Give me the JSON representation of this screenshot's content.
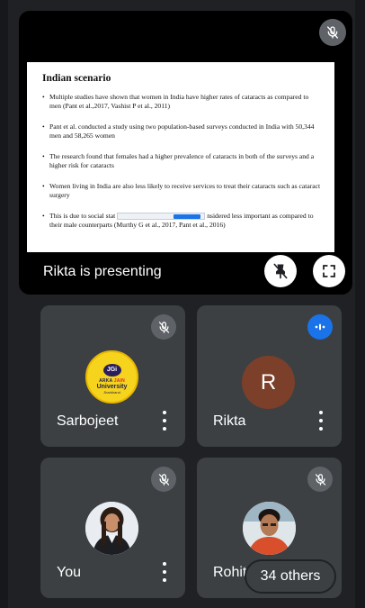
{
  "presentation": {
    "label": "Rikta is presenting",
    "slide": {
      "title": "Indian scenario",
      "bullets": [
        "Multiple studies have shown that women in India have higher rates of cataracts as compared to men (Pant et al.,2017, Vashist P et al., 2011)",
        "Pant et al. conducted a study using two population-based surveys conducted in India with 50,344 men and 58,265 women",
        "The research found that females had a higher prevalence of cataracts in both of the surveys and a higher risk for cataracts",
        "Women living in India are also less likely to receive services to treat their cataracts such as cataract surgery"
      ],
      "last_bullet_start": "This is due to social stat",
      "last_bullet_end": "nsidered less important as compared to their male counterparts (Murthy G et al., 2017, Pant et al., 2016)"
    }
  },
  "participants": [
    {
      "name": "Sarbojeet",
      "avatar": "logo",
      "logo": {
        "mark": "JGi",
        "line1_a": "ARKA",
        "line1_b": "JAIN",
        "line2": "University",
        "line3": "Jharkhand"
      },
      "mic": "mic-off-icon"
    },
    {
      "name": "Rikta",
      "avatar": "R",
      "avatar_color": "#7b3f2a",
      "mic": "speaking-icon"
    },
    {
      "name": "You",
      "avatar": "photo",
      "mic": "mic-off-icon"
    },
    {
      "name": "Rohit",
      "avatar": "photo",
      "mic": "mic-off-icon"
    }
  ],
  "others_label": "34 others",
  "colors": {
    "background": "#202124",
    "tile": "#3c4043",
    "accent": "#1a73e8"
  }
}
